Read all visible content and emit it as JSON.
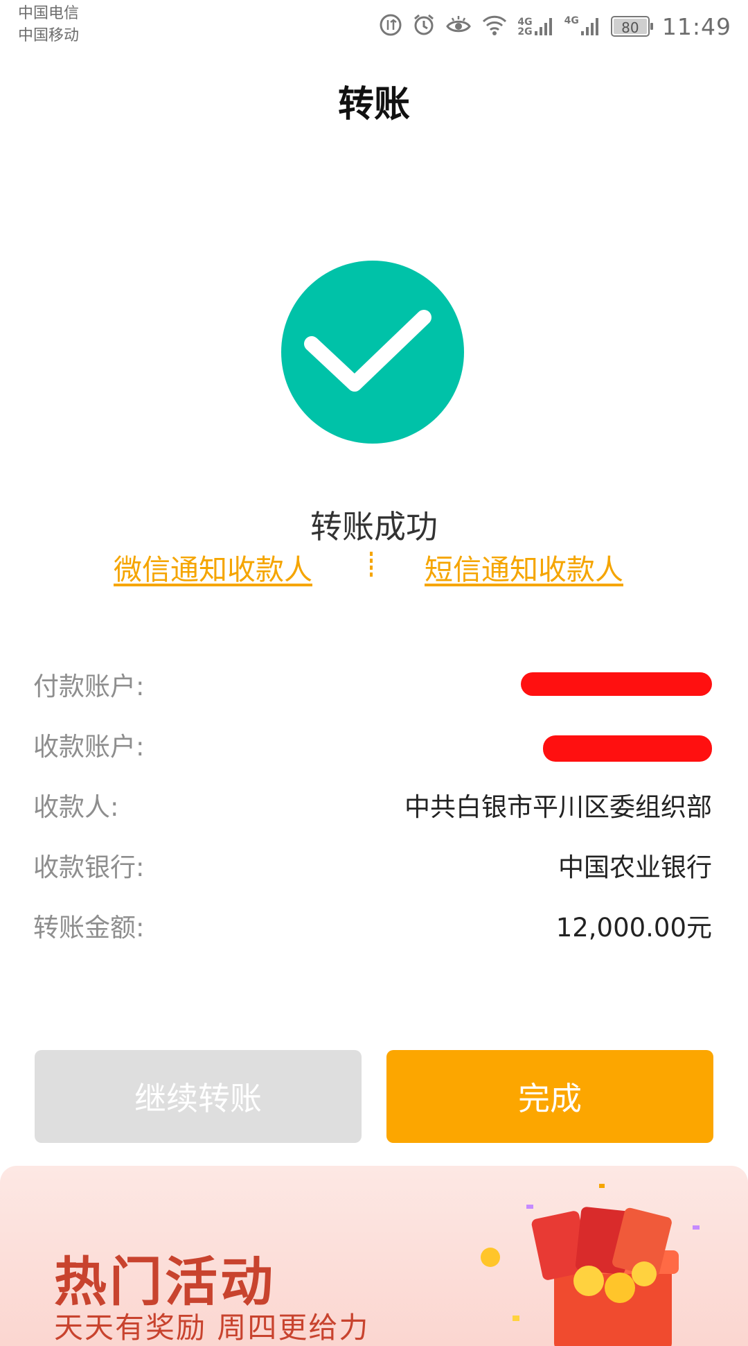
{
  "status_bar": {
    "carrier1": "中国电信",
    "carrier2": "中国移动",
    "net1": "4G",
    "net1b": "2G",
    "net2": "4G",
    "battery": "80",
    "time": "11:49",
    "icons": [
      "data-saver-icon",
      "alarm-icon",
      "eye-comfort-icon",
      "wifi-icon",
      "signal-icon",
      "signal-icon",
      "battery-icon"
    ]
  },
  "header": {
    "title": "转账"
  },
  "result": {
    "status_icon": "check-icon",
    "status_text": "转账成功",
    "accent_color": "#00c2a8"
  },
  "notify": {
    "wechat": "微信通知收款人",
    "sms": "短信通知收款人",
    "color": "#f5a500"
  },
  "details": [
    {
      "label": "付款账户:",
      "value": ""
    },
    {
      "label": "收款账户:",
      "value": ""
    },
    {
      "label": "收款人:",
      "value": "中共白银市平川区委组织部"
    },
    {
      "label": "收款银行:",
      "value": "中国农业银行"
    },
    {
      "label": "转账金额:",
      "value": "12,000.00元"
    }
  ],
  "buttons": {
    "continue": "继续转账",
    "done": "完成",
    "done_color": "#fca600"
  },
  "promo": {
    "title": "热门活动",
    "subtitle": "天天有奖励 周四更给力"
  }
}
